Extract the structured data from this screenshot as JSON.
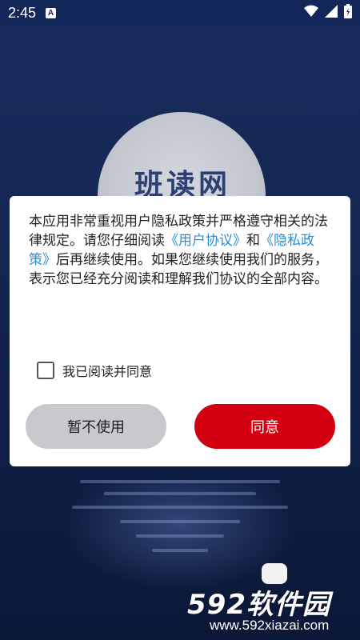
{
  "status_bar": {
    "time": "2:45",
    "icons": [
      "a-icon",
      "wifi-icon",
      "signal-icon",
      "battery-icon"
    ]
  },
  "background": {
    "app_title": "班读网"
  },
  "dialog": {
    "text_before_link1": "本应用非常重视用户隐私政策并严格遵守相关的法律规定。请您仔细阅读",
    "link_user_agreement": "《用户协议》",
    "text_and": "和",
    "link_privacy_policy": "《隐私政策》",
    "text_after_links": "后再继续使用。如果您继续使用我们的服务，表示您已经充分阅读和理解我们协议的全部内容。",
    "agree_checkbox_label": "我已阅读并同意",
    "agree_checked": false,
    "decline_label": "暂不使用",
    "accept_label": "同意"
  },
  "watermark": {
    "logo_text": "592软件园",
    "url": "www.592xiazai.com"
  },
  "colors": {
    "accent_red": "#d3000f",
    "link_blue": "#2a8fd6",
    "decline_gray": "#c9c8cd",
    "background_navy": "#142650"
  }
}
